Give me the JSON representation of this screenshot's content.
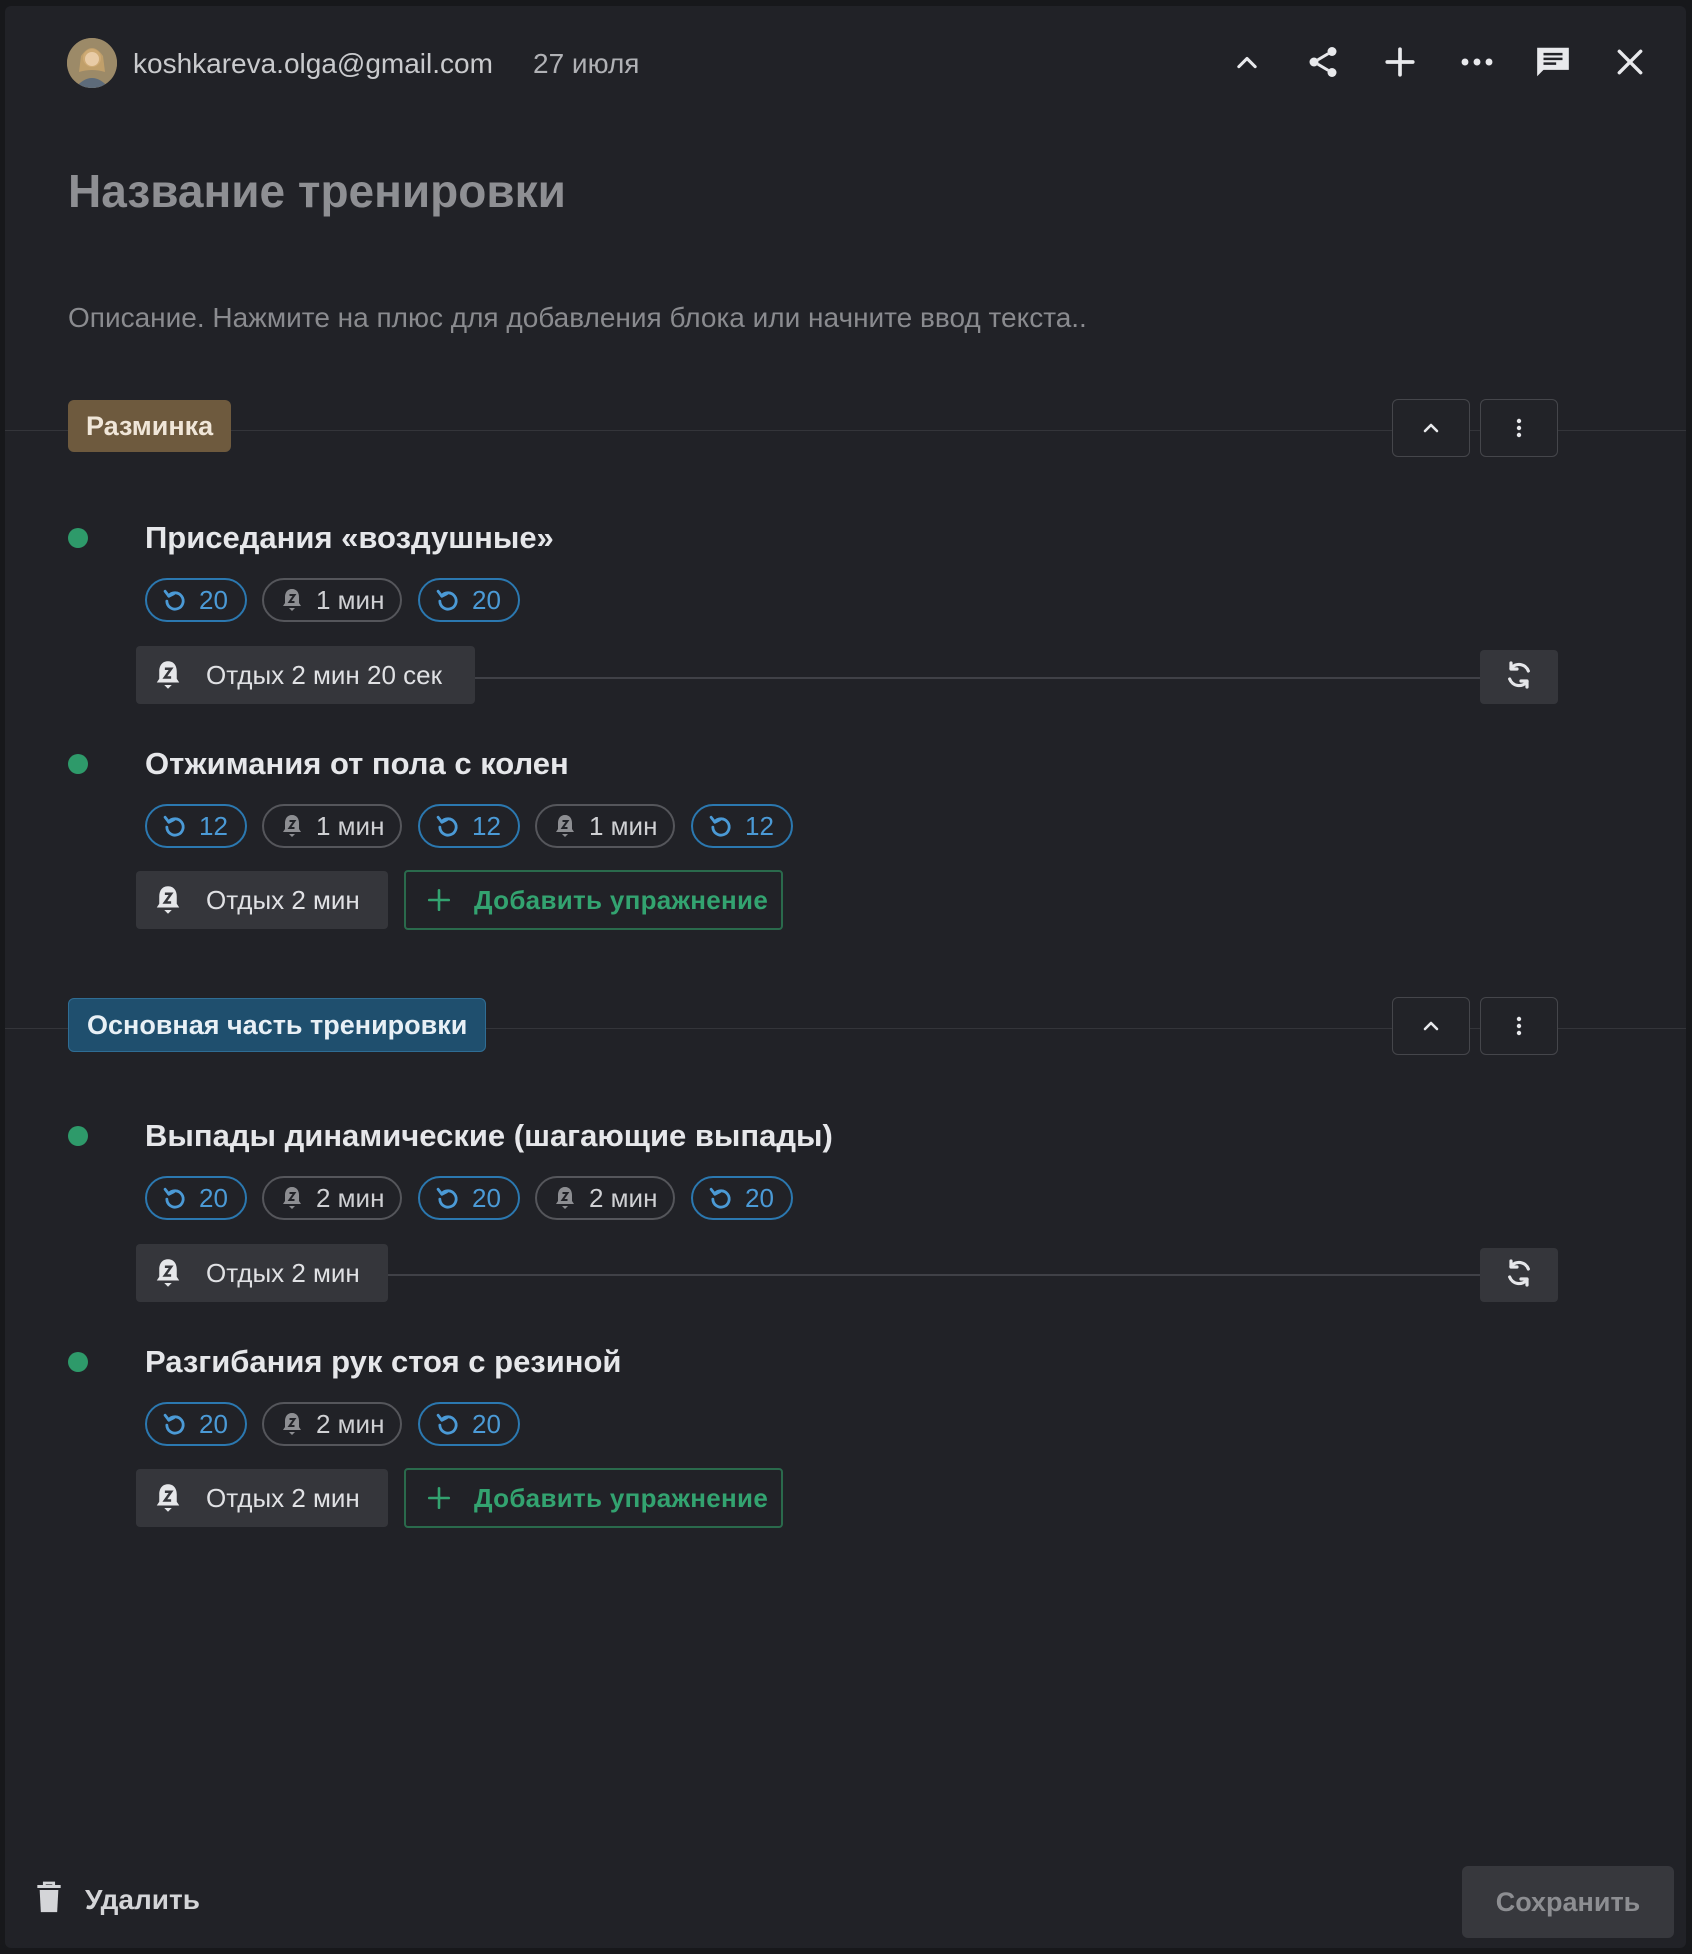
{
  "header": {
    "email": "koshkareva.olga@gmail.com",
    "date": "27 июля",
    "icons": [
      "chevron-up-icon",
      "share-icon",
      "plus-icon",
      "more-horizontal-icon",
      "comment-icon",
      "close-icon"
    ]
  },
  "workout": {
    "title": "Название тренировки",
    "description": "Описание. Нажмите на плюс для добавления блока или начните ввод текста.."
  },
  "sections": [
    {
      "label": "Разминка",
      "color": "#6e5a3e",
      "exercises": [
        {
          "name": "Приседания «воздушные»",
          "sets": [
            {
              "type": "rep",
              "value": "20"
            },
            {
              "type": "rest",
              "value": "1 мин"
            },
            {
              "type": "rep",
              "value": "20"
            }
          ],
          "rest_after": "Отдых 2 мин 20 сек"
        },
        {
          "name": "Отжимания от пола с колен",
          "sets": [
            {
              "type": "rep",
              "value": "12"
            },
            {
              "type": "rest",
              "value": "1 мин"
            },
            {
              "type": "rep",
              "value": "12"
            },
            {
              "type": "rest",
              "value": "1 мин"
            },
            {
              "type": "rep",
              "value": "12"
            }
          ],
          "rest_after": "Отдых 2 мин"
        }
      ],
      "add_label": "Добавить упражнение"
    },
    {
      "label": "Основная часть тренировки",
      "color": "#1f4f6e",
      "exercises": [
        {
          "name": "Выпады динамические (шагающие выпады)",
          "sets": [
            {
              "type": "rep",
              "value": "20"
            },
            {
              "type": "rest",
              "value": "2 мин"
            },
            {
              "type": "rep",
              "value": "20"
            },
            {
              "type": "rest",
              "value": "2 мин"
            },
            {
              "type": "rep",
              "value": "20"
            }
          ],
          "rest_after": "Отдых 2 мин"
        },
        {
          "name": "Разгибания рук стоя с резиной",
          "sets": [
            {
              "type": "rep",
              "value": "20"
            },
            {
              "type": "rest",
              "value": "2 мин"
            },
            {
              "type": "rep",
              "value": "20"
            }
          ],
          "rest_after": "Отдых 2 мин"
        }
      ],
      "add_label": "Добавить упражнение"
    }
  ],
  "footer": {
    "delete_label": "Удалить",
    "save_label": "Сохранить"
  }
}
